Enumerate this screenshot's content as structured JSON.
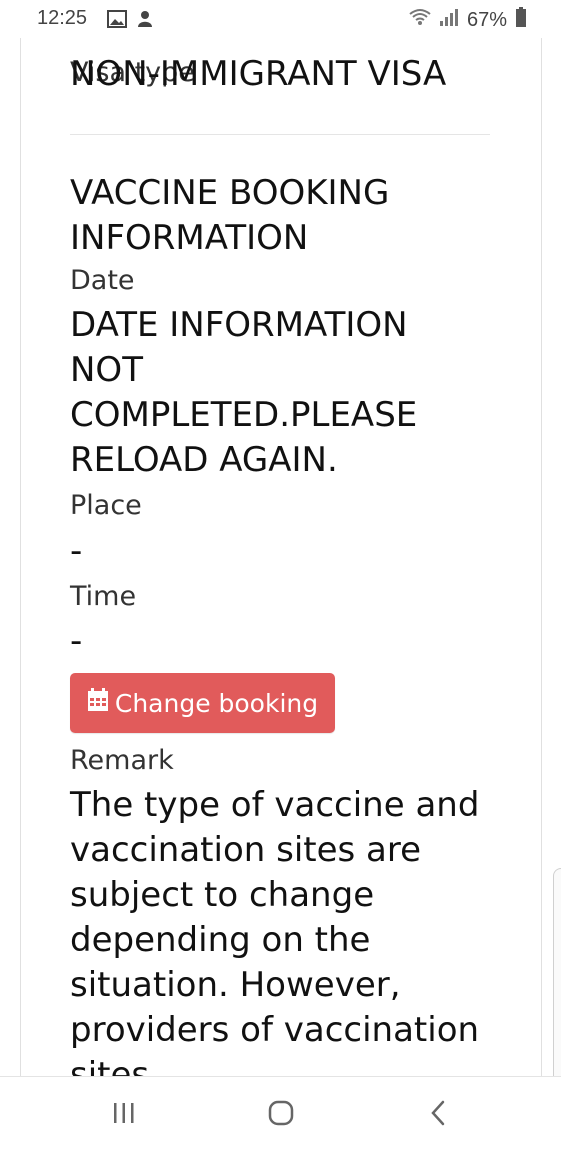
{
  "status_bar": {
    "time": "12:25",
    "battery": "67%",
    "icons": [
      "gallery-icon",
      "notification-icon",
      "wifi-icon",
      "signal-icon",
      "battery-icon"
    ]
  },
  "visa": {
    "label": "Visa type",
    "value": "NON-IMMIGRANT VISA"
  },
  "vaccine_booking": {
    "title": "VACCINE BOOKING INFORMATION",
    "date_label": "Date",
    "date_value": "DATE INFORMATION NOT COMPLETED.PLEASE RELOAD AGAIN.",
    "place_label": "Place",
    "place_value": "-",
    "time_label": "Time",
    "time_value": "-",
    "change_button": "Change booking",
    "remark_label": "Remark",
    "remark_text": "The type of vaccine and vaccination sites are subject to change depending on the situation. However, providers of vaccination sites"
  },
  "colors": {
    "button": "#e15b5b",
    "divider": "#e5e5e5"
  },
  "nav_bar": {
    "icons": [
      "recent-apps-icon",
      "home-icon",
      "back-icon"
    ]
  }
}
